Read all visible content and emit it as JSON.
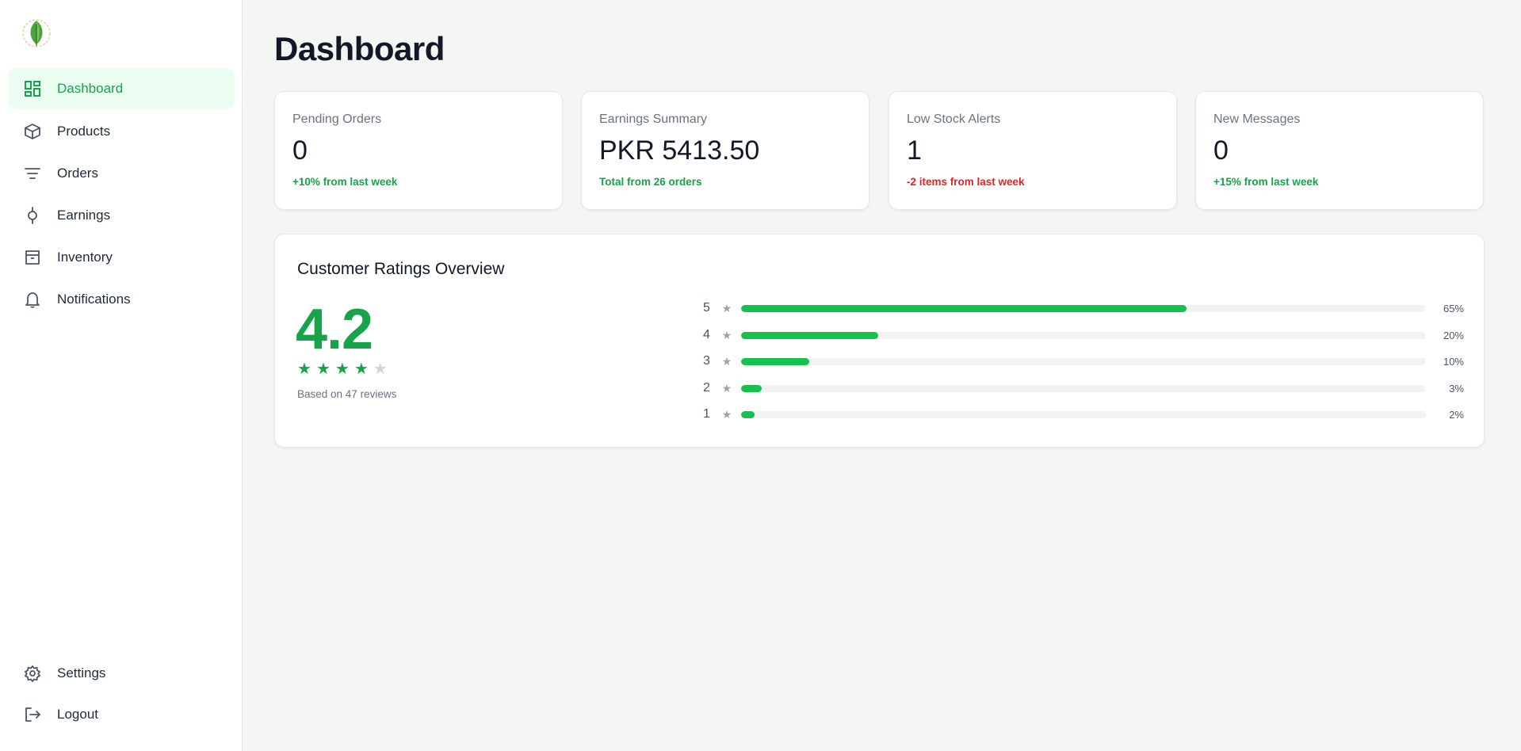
{
  "sidebar": {
    "items": [
      {
        "label": "Dashboard",
        "icon": "dashboard-icon",
        "active": true
      },
      {
        "label": "Products",
        "icon": "box-icon"
      },
      {
        "label": "Orders",
        "icon": "filter-icon"
      },
      {
        "label": "Earnings",
        "icon": "coin-icon"
      },
      {
        "label": "Inventory",
        "icon": "archive-icon"
      },
      {
        "label": "Notifications",
        "icon": "bell-icon"
      }
    ],
    "bottom_items": [
      {
        "label": "Settings",
        "icon": "gear-icon"
      },
      {
        "label": "Logout",
        "icon": "logout-icon"
      }
    ]
  },
  "page": {
    "title": "Dashboard"
  },
  "cards": [
    {
      "label": "Pending Orders",
      "value": "0",
      "note": "+10% from last week",
      "note_color": "#16a34a"
    },
    {
      "label": "Earnings Summary",
      "value": "PKR 5413.50",
      "note": "Total from 26 orders",
      "note_color": "#16a34a"
    },
    {
      "label": "Low Stock Alerts",
      "value": "1",
      "note": "-2 items from last week",
      "note_color": "#dc2626"
    },
    {
      "label": "New Messages",
      "value": "0",
      "note": "+15% from last week",
      "note_color": "#16a34a"
    }
  ],
  "ratings": {
    "title": "Customer Ratings Overview",
    "average": "4.2",
    "stars_filled": 4,
    "stars_total": 5,
    "reviews_text": "Based on 47 reviews",
    "breakdown": [
      {
        "stars": "5",
        "percent": 65,
        "label": "65%"
      },
      {
        "stars": "4",
        "percent": 20,
        "label": "20%"
      },
      {
        "stars": "3",
        "percent": 10,
        "label": "10%"
      },
      {
        "stars": "2",
        "percent": 3,
        "label": "3%"
      },
      {
        "stars": "1",
        "percent": 2,
        "label": "2%"
      }
    ]
  },
  "colors": {
    "accent": "#16a34a",
    "bar": "#16c24d",
    "alert": "#dc2626"
  }
}
